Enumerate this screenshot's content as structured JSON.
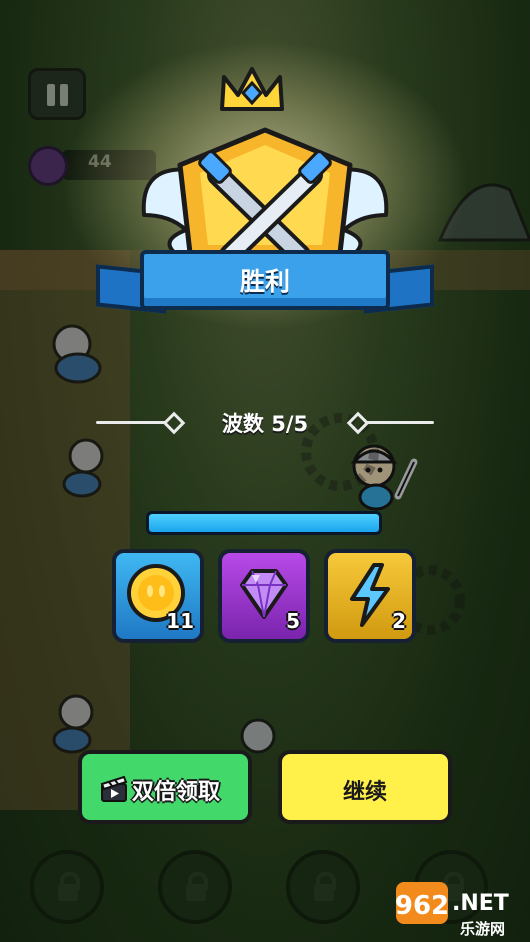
{
  "hud": {
    "score": "44"
  },
  "victory": {
    "title": "胜利",
    "wave_text": "波数 5/5",
    "wave_progress": 1.0
  },
  "rewards": [
    {
      "type": "coin",
      "icon": "coin-icon",
      "count": "11",
      "card_color": "#3fb8f2",
      "border": "#1f78c4"
    },
    {
      "type": "gem",
      "icon": "gem-icon",
      "count": "5",
      "card_color": "#b84ae8",
      "border": "#7a24ad"
    },
    {
      "type": "energy",
      "icon": "lightning-icon",
      "count": "2",
      "card_color": "#f7c93a",
      "border": "#d19a10"
    }
  ],
  "buttons": {
    "double_claim": "双倍领取",
    "continue": "继续"
  },
  "colors": {
    "green_button": "#43d96a",
    "yellow_button": "#fff04a",
    "banner_blue": "#3aa1ea",
    "progress_blue": "#1aa4ec"
  },
  "watermark": {
    "brand": "962.NET",
    "sub": "乐游网"
  }
}
